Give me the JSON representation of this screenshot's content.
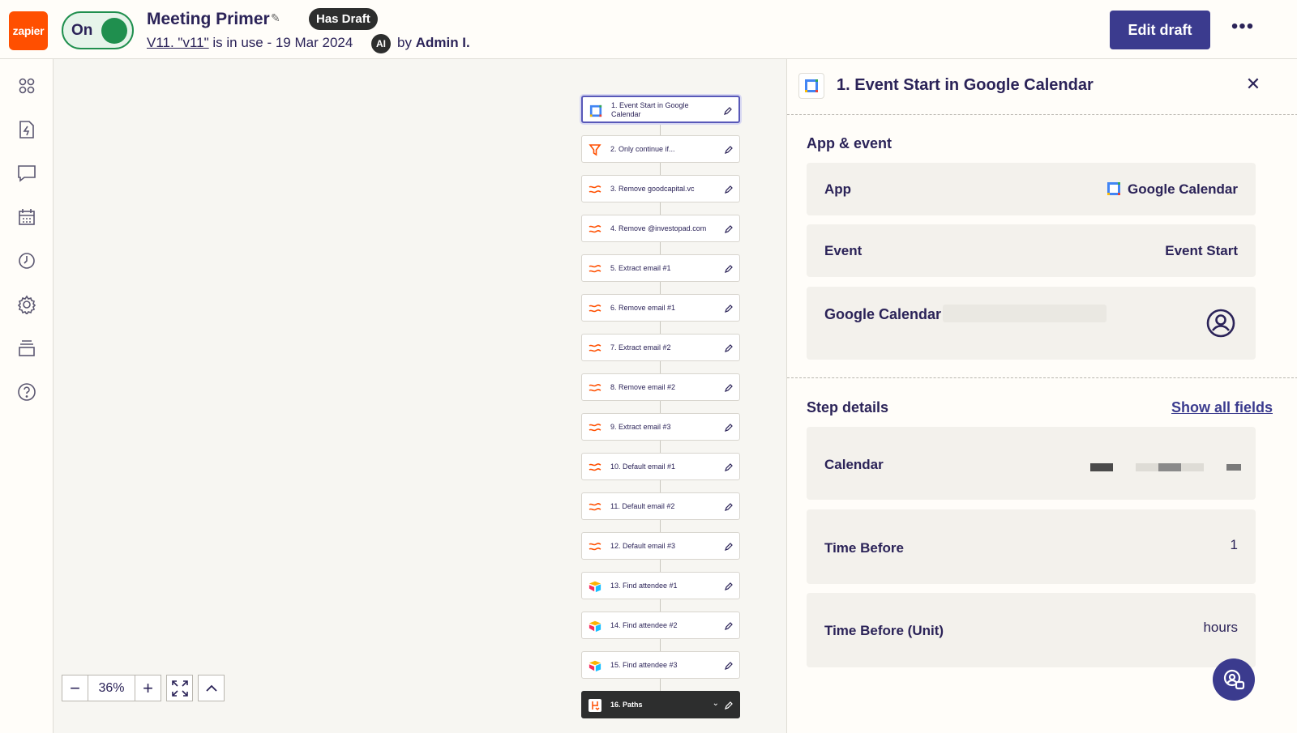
{
  "header": {
    "logo_text": "zapier",
    "toggle_label": "On",
    "zap_title": "Meeting Primer",
    "draft_badge": "Has Draft",
    "version_link": "V11. \"v11\"",
    "version_status": " is in use - 19 Mar 2024",
    "ai_badge": "AI",
    "by_prefix": "by ",
    "author": "Admin I.",
    "edit_draft_label": "Edit draft",
    "more_label": "•••"
  },
  "sidebar": {
    "items": [
      {
        "icon": "apps-icon"
      },
      {
        "icon": "zaps-icon"
      },
      {
        "icon": "chat-icon"
      },
      {
        "icon": "calendar-grid-icon"
      },
      {
        "icon": "history-icon"
      },
      {
        "icon": "settings-icon"
      },
      {
        "icon": "layers-icon"
      },
      {
        "icon": "help-icon"
      }
    ]
  },
  "canvas": {
    "steps": [
      {
        "label": "1. Event Start in Google Calendar",
        "icon": "google-calendar-icon",
        "state": "selected"
      },
      {
        "label": "2. Only continue if...",
        "icon": "filter-icon"
      },
      {
        "label": "3. Remove goodcapital.vc",
        "icon": "formatter-icon"
      },
      {
        "label": "4. Remove @investopad.com",
        "icon": "formatter-icon"
      },
      {
        "label": "5. Extract email #1",
        "icon": "formatter-icon"
      },
      {
        "label": "6. Remove email #1",
        "icon": "formatter-icon"
      },
      {
        "label": "7. Extract email #2",
        "icon": "formatter-icon"
      },
      {
        "label": "8. Remove email #2",
        "icon": "formatter-icon"
      },
      {
        "label": "9. Extract email #3",
        "icon": "formatter-icon"
      },
      {
        "label": "10. Default email #1",
        "icon": "formatter-icon"
      },
      {
        "label": "11. Default email #2",
        "icon": "formatter-icon"
      },
      {
        "label": "12. Default email #3",
        "icon": "formatter-icon"
      },
      {
        "label": "13. Find attendee #1",
        "icon": "airtable-icon"
      },
      {
        "label": "14. Find attendee #2",
        "icon": "airtable-icon"
      },
      {
        "label": "15. Find attendee #3",
        "icon": "airtable-icon"
      },
      {
        "label": "16. Paths",
        "icon": "paths-icon",
        "state": "dark"
      }
    ],
    "zoom": {
      "minus": "−",
      "value": "36%",
      "plus": "+"
    }
  },
  "panel": {
    "title": "1. Event Start in Google Calendar",
    "close_label": "✕",
    "app_event": {
      "heading": "App & event",
      "app_label": "App",
      "app_value": "Google Calendar",
      "event_label": "Event",
      "event_value": "Event Start",
      "account_label": "Google Calendar"
    },
    "step_details": {
      "heading": "Step details",
      "show_all": "Show all fields",
      "fields": [
        {
          "label": "Calendar",
          "value": ""
        },
        {
          "label": "Time Before",
          "value": "1"
        },
        {
          "label": "Time Before (Unit)",
          "value": "hours"
        }
      ]
    }
  },
  "colors": {
    "brand": "#ff4f00",
    "accent": "#3b3b8e",
    "on_green": "#1f8f4e"
  }
}
